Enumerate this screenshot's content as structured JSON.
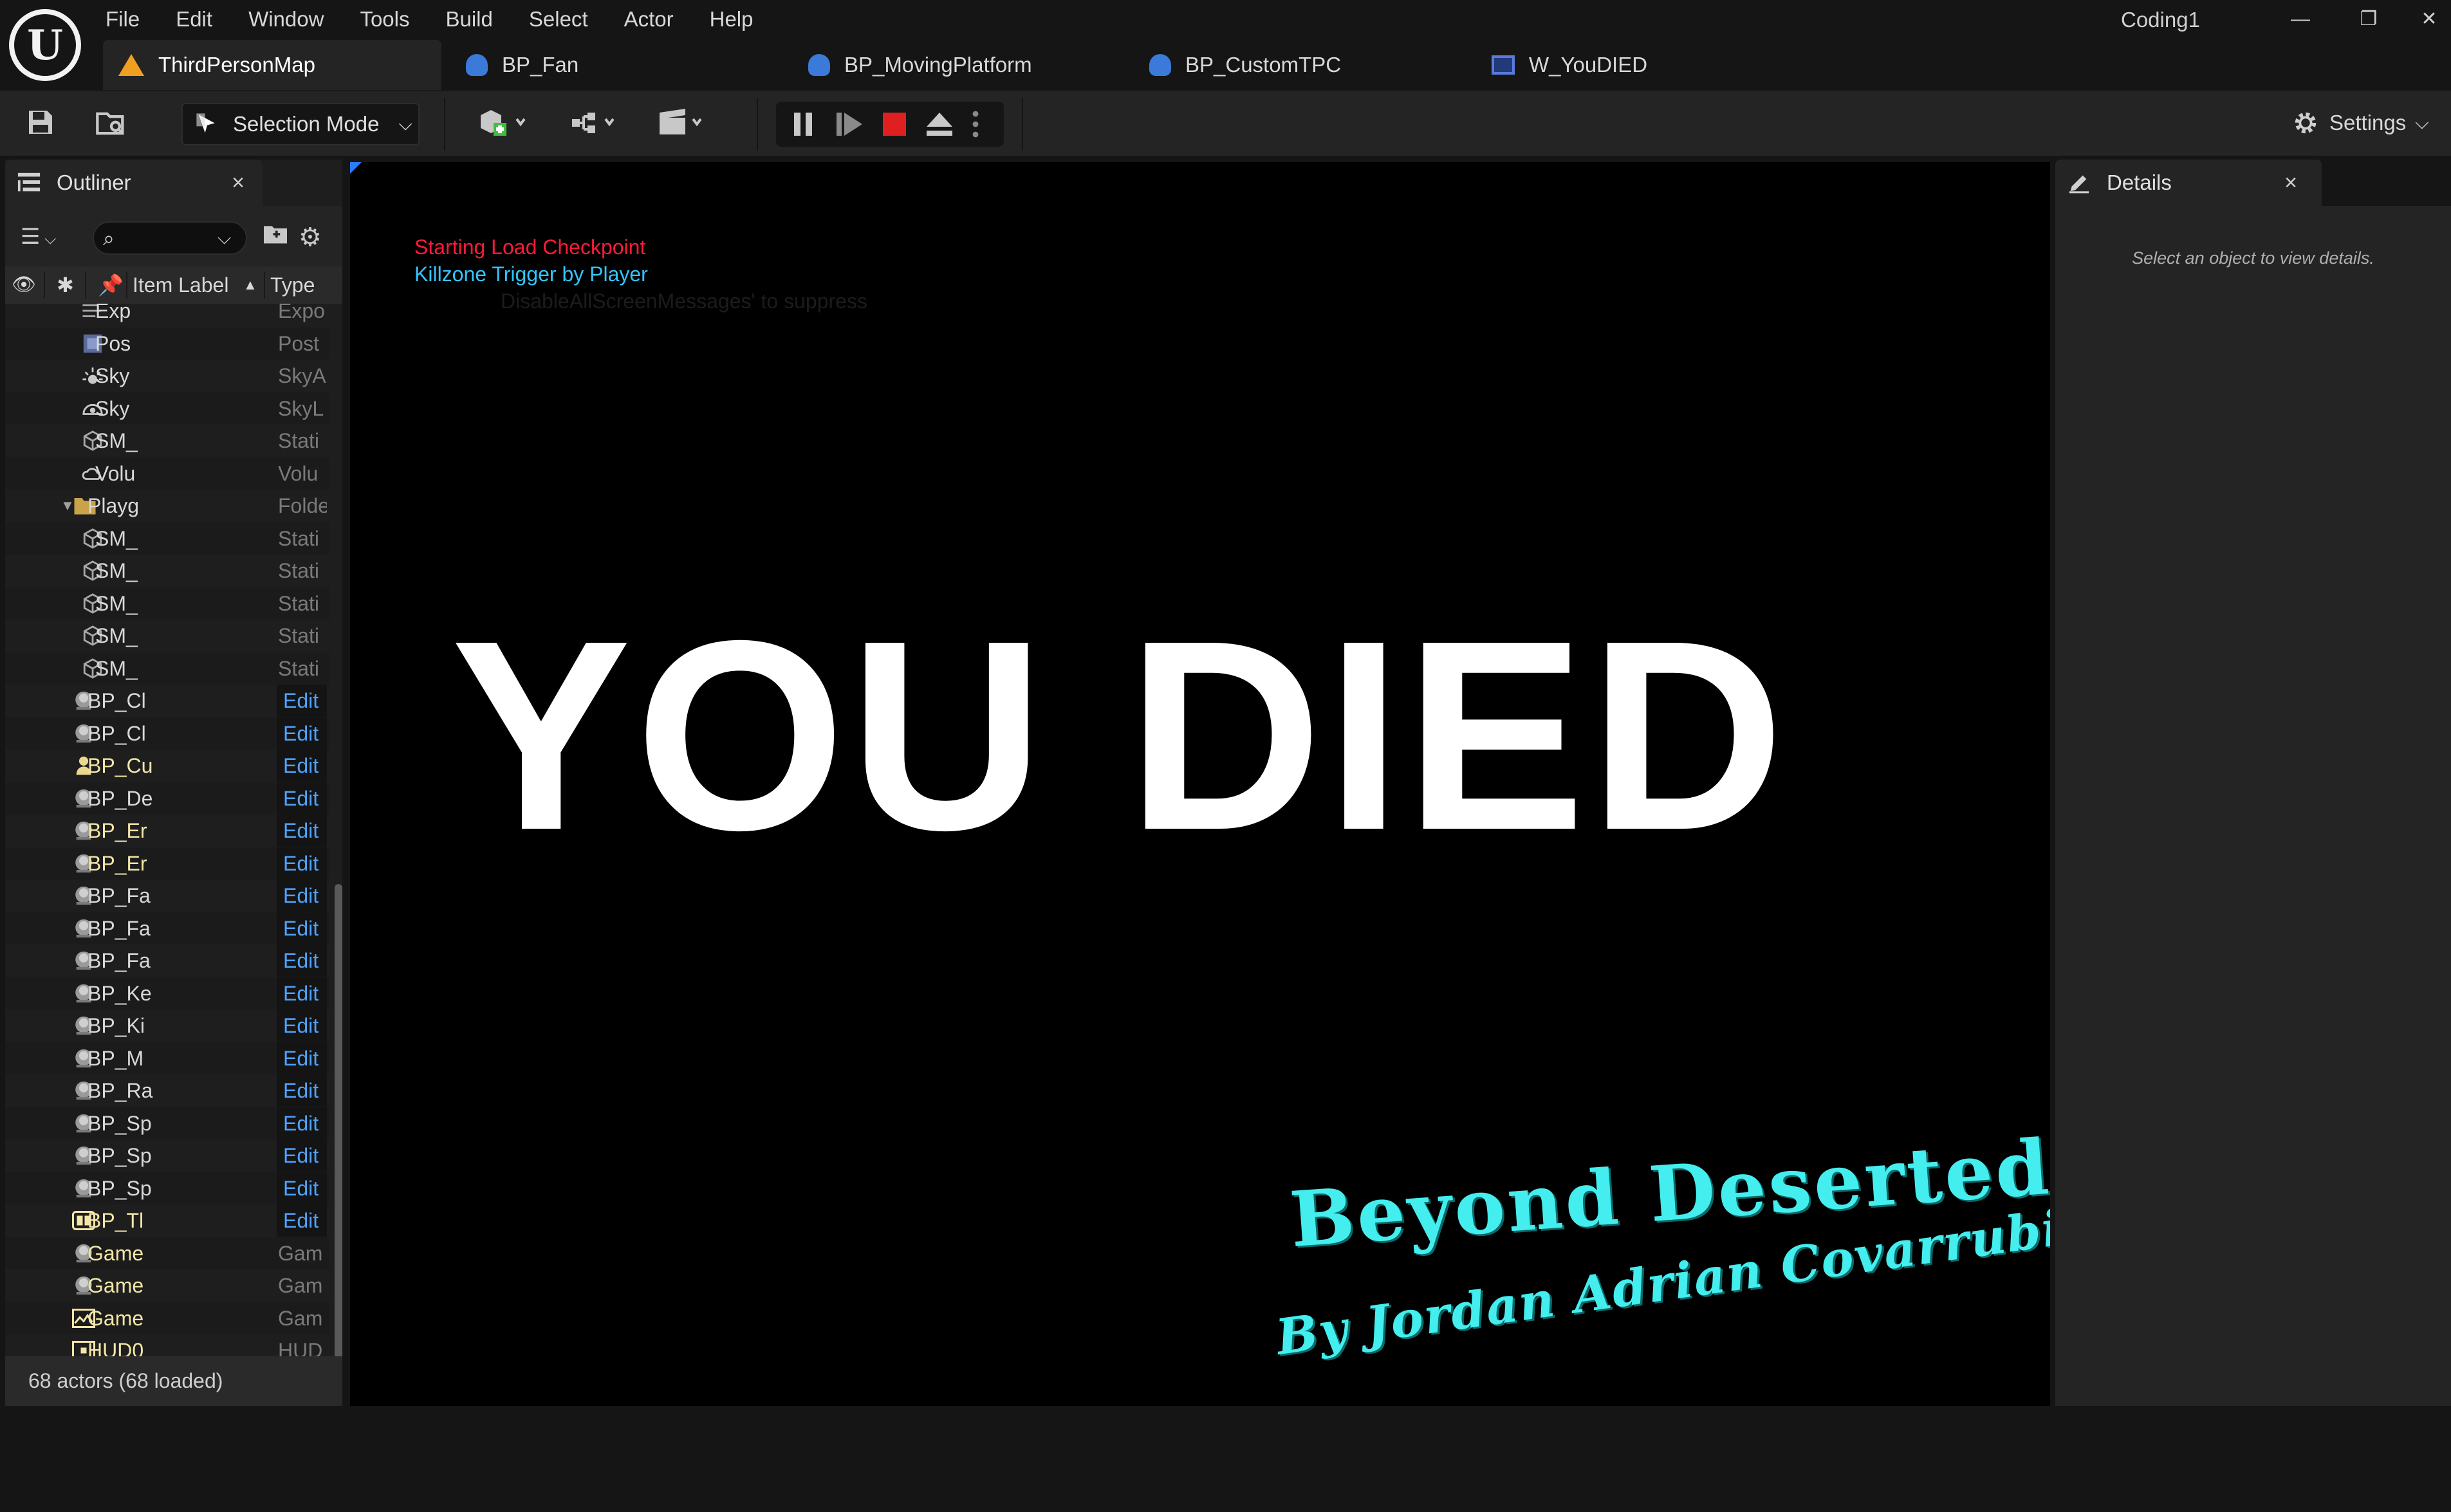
{
  "menu": {
    "items": [
      "File",
      "Edit",
      "Window",
      "Tools",
      "Build",
      "Select",
      "Actor",
      "Help"
    ],
    "project_name": "Coding1"
  },
  "tabs": [
    {
      "label": "ThirdPersonMap",
      "icon": "map-icon"
    },
    {
      "label": "BP_Fan",
      "icon": "blueprint-icon"
    },
    {
      "label": "BP_MovingPlatform",
      "icon": "blueprint-icon"
    },
    {
      "label": "BP_CustomTPC",
      "icon": "blueprint-icon"
    },
    {
      "label": "W_YouDIED",
      "icon": "widget-icon"
    }
  ],
  "toolbar": {
    "selection_mode": "Selection Mode",
    "settings_label": "Settings",
    "stop_color": "#e02020"
  },
  "outliner": {
    "title": "Outliner",
    "search_value": "",
    "columns": [
      "Item Label",
      "Type"
    ],
    "status": "68 actors (68 loaded)",
    "rows": [
      {
        "label": "Exp",
        "type": "Expo",
        "icon": "exponential-fog-icon",
        "indent": 1
      },
      {
        "label": "Pos",
        "type": "Post",
        "icon": "post-process-icon",
        "indent": 1
      },
      {
        "label": "Sky",
        "type": "SkyA",
        "icon": "sky-atmosphere-icon",
        "indent": 1
      },
      {
        "label": "Sky",
        "type": "SkyL",
        "icon": "sky-light-icon",
        "indent": 1
      },
      {
        "label": "SM_",
        "type": "Stati",
        "icon": "static-mesh-icon",
        "indent": 1
      },
      {
        "label": "Volu",
        "type": "Volu",
        "icon": "volumetric-cloud-icon",
        "indent": 1
      },
      {
        "label": "Playg",
        "type": "Folde",
        "icon": "folder-icon",
        "indent": 0,
        "folder": true
      },
      {
        "label": "SM_",
        "type": "Stati",
        "icon": "static-mesh-icon",
        "indent": 1
      },
      {
        "label": "SM_",
        "type": "Stati",
        "icon": "static-mesh-icon",
        "indent": 1
      },
      {
        "label": "SM_",
        "type": "Stati",
        "icon": "static-mesh-icon",
        "indent": 1
      },
      {
        "label": "SM_",
        "type": "Stati",
        "icon": "static-mesh-icon",
        "indent": 1
      },
      {
        "label": "SM_",
        "type": "Stati",
        "icon": "static-mesh-icon",
        "indent": 1
      },
      {
        "label": "BP_Cl",
        "type": "Edit",
        "icon": "actor-icon",
        "indent": 0,
        "edit": true
      },
      {
        "label": "BP_Cl",
        "type": "Edit",
        "icon": "actor-icon",
        "indent": 0,
        "edit": true
      },
      {
        "label": "BP_Cu",
        "type": "Edit",
        "icon": "character-icon",
        "indent": 0,
        "edit": true,
        "yellow": true
      },
      {
        "label": "BP_De",
        "type": "Edit",
        "icon": "actor-icon",
        "indent": 0,
        "edit": true
      },
      {
        "label": "BP_Er",
        "type": "Edit",
        "icon": "actor-icon",
        "indent": 0,
        "edit": true,
        "yellow": true
      },
      {
        "label": "BP_Er",
        "type": "Edit",
        "icon": "actor-icon",
        "indent": 0,
        "edit": true,
        "yellow": true
      },
      {
        "label": "BP_Fa",
        "type": "Edit",
        "icon": "actor-icon",
        "indent": 0,
        "edit": true
      },
      {
        "label": "BP_Fa",
        "type": "Edit",
        "icon": "actor-icon",
        "indent": 0,
        "edit": true
      },
      {
        "label": "BP_Fa",
        "type": "Edit",
        "icon": "actor-icon",
        "indent": 0,
        "edit": true
      },
      {
        "label": "BP_Ke",
        "type": "Edit",
        "icon": "actor-icon",
        "indent": 0,
        "edit": true
      },
      {
        "label": "BP_Ki",
        "type": "Edit",
        "icon": "actor-icon",
        "indent": 0,
        "edit": true
      },
      {
        "label": "BP_M",
        "type": "Edit",
        "icon": "actor-icon",
        "indent": 0,
        "edit": true
      },
      {
        "label": "BP_Ra",
        "type": "Edit",
        "icon": "actor-icon",
        "indent": 0,
        "edit": true
      },
      {
        "label": "BP_Sp",
        "type": "Edit",
        "icon": "actor-icon",
        "indent": 0,
        "edit": true
      },
      {
        "label": "BP_Sp",
        "type": "Edit",
        "icon": "actor-icon",
        "indent": 0,
        "edit": true
      },
      {
        "label": "BP_Sp",
        "type": "Edit",
        "icon": "actor-icon",
        "indent": 0,
        "edit": true
      },
      {
        "label": "BP_Tl",
        "type": "Edit",
        "icon": "trigger-icon",
        "indent": 0,
        "edit": true,
        "yellow": true
      },
      {
        "label": "Game",
        "type": "Gam",
        "icon": "actor-icon",
        "indent": 0,
        "yellow": true
      },
      {
        "label": "Game",
        "type": "Gam",
        "icon": "actor-icon",
        "indent": 0,
        "yellow": true
      },
      {
        "label": "Game",
        "type": "Gam",
        "icon": "game-state-icon",
        "indent": 0,
        "yellow": true
      },
      {
        "label": "HUD0",
        "type": "HUD",
        "icon": "hud-icon",
        "indent": 0,
        "yellow": true
      }
    ]
  },
  "viewport": {
    "debug_messages": [
      "Starting Load Checkpoint",
      "Killzone Trigger by Player",
      "DisableAllScreenMessages' to suppress"
    ],
    "death_text": "YOU DIED",
    "game_title": "Beyond Deserted",
    "game_author": "By Jordan Adrian Covarrubias",
    "accent": "#44eeee"
  },
  "details": {
    "title": "Details",
    "empty_message": "Select an object to view details."
  }
}
